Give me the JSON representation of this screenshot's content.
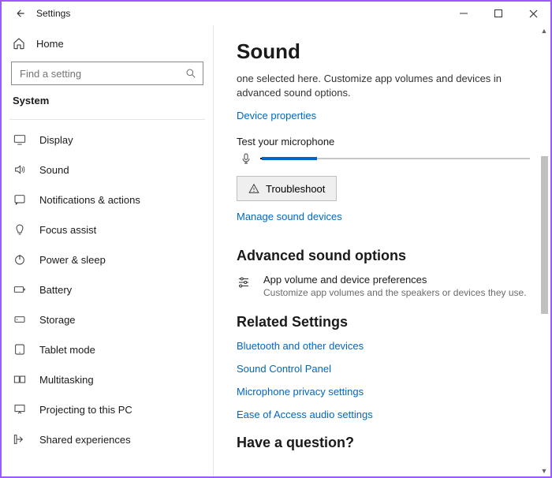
{
  "window": {
    "title": "Settings"
  },
  "sidebar": {
    "home": "Home",
    "search_placeholder": "Find a setting",
    "section": "System",
    "items": [
      {
        "label": "Display"
      },
      {
        "label": "Sound"
      },
      {
        "label": "Notifications & actions"
      },
      {
        "label": "Focus assist"
      },
      {
        "label": "Power & sleep"
      },
      {
        "label": "Battery"
      },
      {
        "label": "Storage"
      },
      {
        "label": "Tablet mode"
      },
      {
        "label": "Multitasking"
      },
      {
        "label": "Projecting to this PC"
      },
      {
        "label": "Shared experiences"
      }
    ]
  },
  "main": {
    "title": "Sound",
    "desc": "one selected here. Customize app volumes and devices in advanced sound options.",
    "device_properties": "Device properties",
    "test_mic": "Test your microphone",
    "troubleshoot": "Troubleshoot",
    "manage_devices": "Manage sound devices",
    "advanced_header": "Advanced sound options",
    "advanced_opt_title": "App volume and device preferences",
    "advanced_opt_desc": "Customize app volumes and the speakers or devices they use.",
    "related_header": "Related Settings",
    "related_links": [
      "Bluetooth and other devices",
      "Sound Control Panel",
      "Microphone privacy settings",
      "Ease of Access audio settings"
    ],
    "question_header": "Have a question?"
  }
}
